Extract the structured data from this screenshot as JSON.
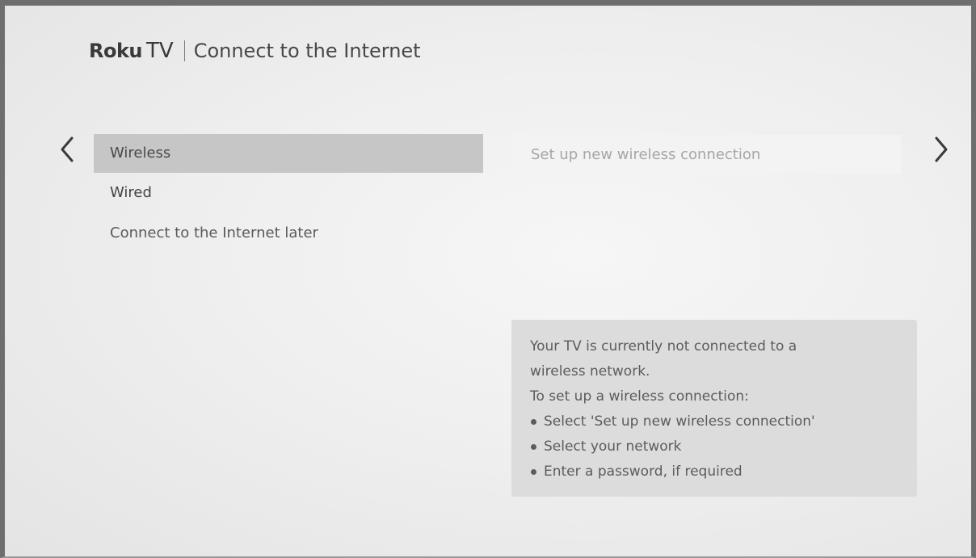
{
  "header": {
    "brand_roku": "Roku",
    "brand_tv": "TV",
    "title": "Connect to the Internet"
  },
  "nav": {
    "left_icon": "chevron-left-icon",
    "right_icon": "chevron-right-icon"
  },
  "menu": {
    "items": [
      {
        "label": "Wireless",
        "selected": true
      },
      {
        "label": "Wired",
        "selected": false
      },
      {
        "label": "Connect to the Internet later",
        "selected": false
      }
    ]
  },
  "submenu": {
    "option_label": "Set up new wireless connection"
  },
  "info": {
    "lines": [
      "Your TV is currently not connected to a",
      "wireless network.",
      "To set up a wireless connection:"
    ],
    "bullets": [
      "Select 'Set up new wireless connection'",
      "Select your network",
      "Enter a password, if required"
    ]
  },
  "colors": {
    "selected_background": "#c6c6c6",
    "screen_background": "#efefef",
    "info_background": "#dcdcdc",
    "frame": "#6e6e6e"
  }
}
